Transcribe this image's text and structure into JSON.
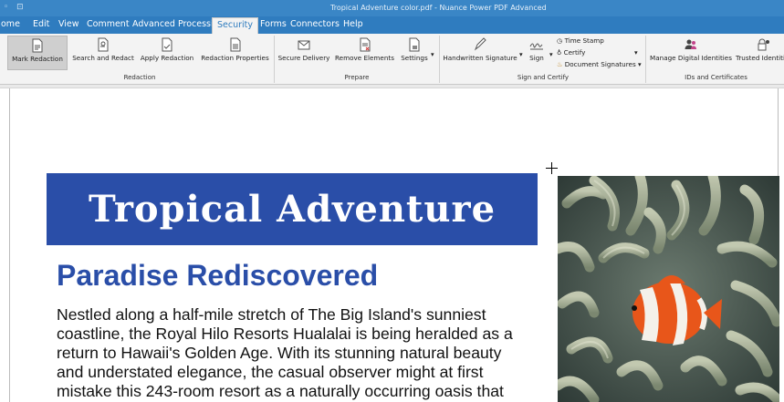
{
  "window": {
    "title": "Tropical Adventure color.pdf - Nuance Power PDF Advanced",
    "quick_access": "◦ ⊡"
  },
  "menu": {
    "items": [
      "ome",
      "Edit",
      "View",
      "Comment",
      "Advanced Processing",
      "Security",
      "Forms",
      "Connectors",
      "Help"
    ],
    "active": "Security"
  },
  "ribbon": {
    "redaction": {
      "mark": "Mark Redaction",
      "search": "Search and Redact",
      "apply": "Apply Redaction",
      "properties": "Redaction Properties",
      "group": "Redaction"
    },
    "prepare": {
      "secure": "Secure Delivery",
      "remove": "Remove Elements",
      "settings": "Settings",
      "group": "Prepare"
    },
    "sign": {
      "handwritten": "Handwritten Signature",
      "sign": "Sign",
      "time_stamp": "Time Stamp",
      "certify": "Certify",
      "document_signatures": "Document Signatures",
      "group": "Sign and Certify"
    },
    "ids": {
      "manage": "Manage Digital Identities",
      "trusted": "Trusted Identiti",
      "group": "IDs and Certificates"
    }
  },
  "document": {
    "banner": "Tropical Adventure",
    "subhead": "Paradise Rediscovered",
    "body_lines": [
      "Nestled along a half-mile stretch of The Big Island's sunniest",
      "coastline, the Royal Hilo Resorts Hualalai is being heralded as a",
      "return to Hawaii's Golden Age. With its stunning natural beauty",
      "and understated elegance, the casual observer might at first",
      "mistake this 243-room resort as a naturally occurring oasis that"
    ]
  },
  "colors": {
    "title_bar": "#3a86c6",
    "menu_bar": "#2f7cbf",
    "banner": "#2a4ea8",
    "subhead": "#2a4ea8"
  }
}
